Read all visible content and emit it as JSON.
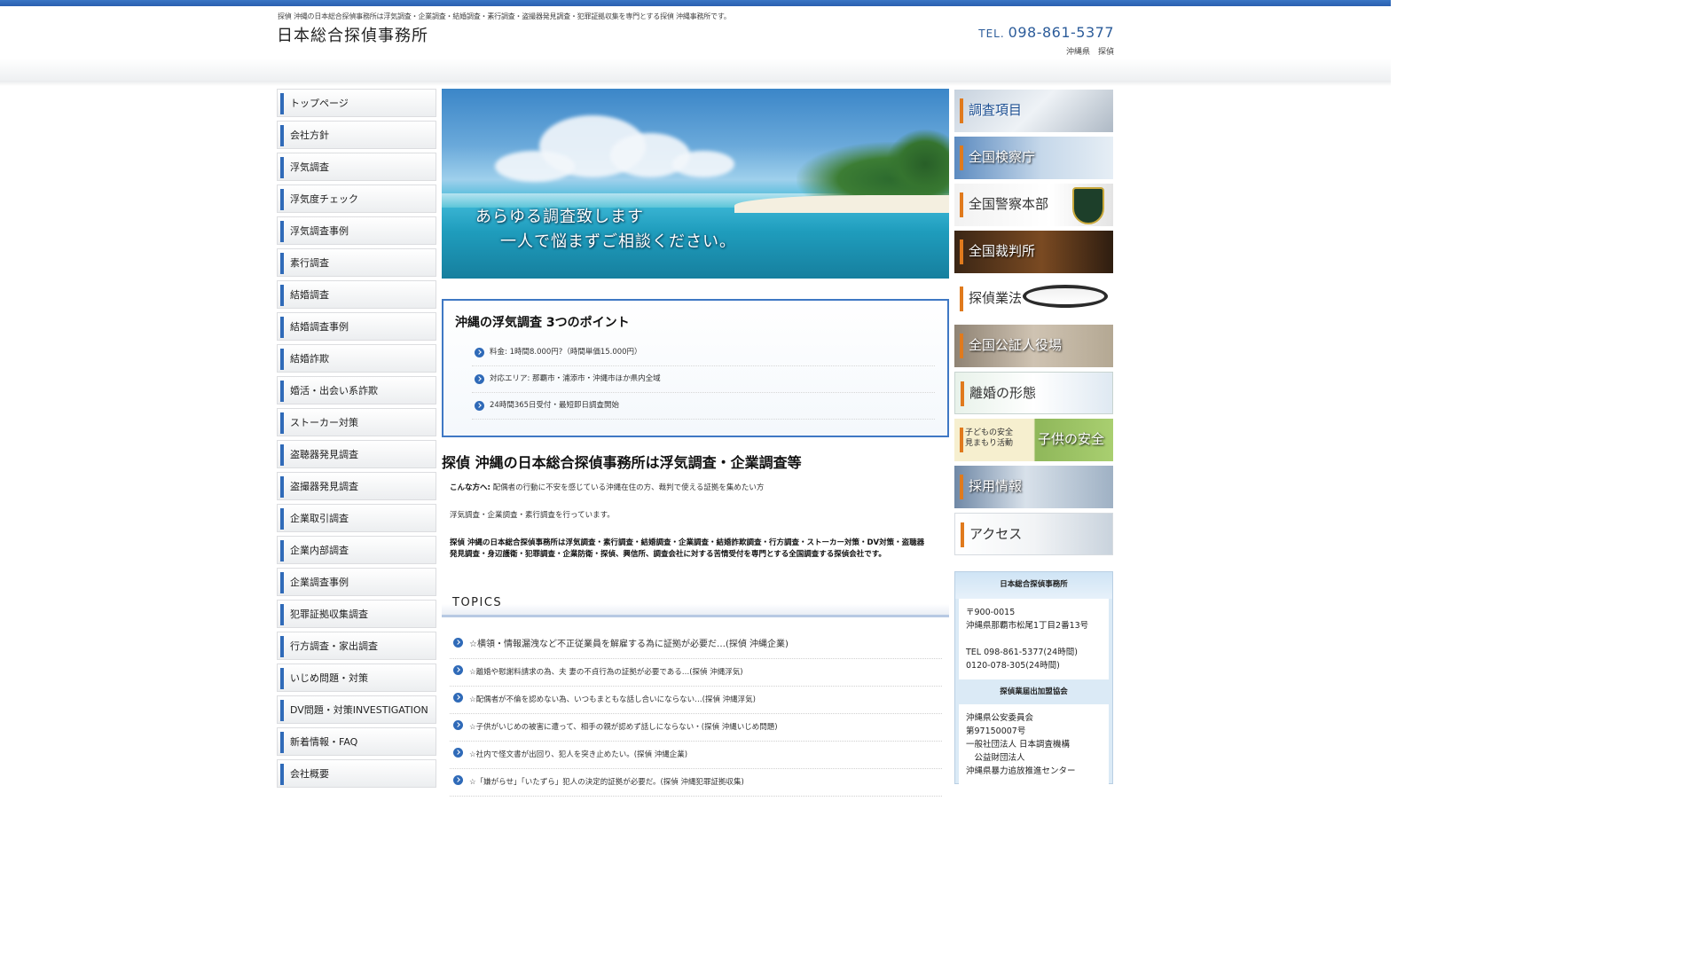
{
  "header": {
    "tagline": "探偵 沖縄の日本総合探偵事務所は浮気調査・企業調査・結婚調査・素行調査・盗撮器発見調査・犯罪証拠収集を専門とする探偵 沖縄事務所です。",
    "site_title": "日本総合探偵事務所",
    "tel_label": "TEL.",
    "tel_number": "098-861-5377",
    "region": "沖縄県　探偵"
  },
  "nav": {
    "items": [
      {
        "label": "トップページ"
      },
      {
        "label": "会社方針"
      },
      {
        "label": "浮気調査"
      },
      {
        "label": "浮気度チェック"
      },
      {
        "label": "浮気調査事例"
      },
      {
        "label": "素行調査"
      },
      {
        "label": "結婚調査"
      },
      {
        "label": "結婚調査事例"
      },
      {
        "label": "結婚詐欺"
      },
      {
        "label": "婚活・出会い系詐欺"
      },
      {
        "label": "ストーカー対策"
      },
      {
        "label": "盗聴器発見調査"
      },
      {
        "label": "盗撮器発見調査"
      },
      {
        "label": "企業取引調査"
      },
      {
        "label": "企業内部調査"
      },
      {
        "label": "企業調査事例"
      },
      {
        "label": "犯罪証拠収集調査"
      },
      {
        "label": "行方調査・家出調査"
      },
      {
        "label": "いじめ問題・対策"
      },
      {
        "label": "DV問題・対策INVESTIGATION"
      },
      {
        "label": "新着情報・FAQ"
      },
      {
        "label": "会社概要"
      }
    ]
  },
  "hero": {
    "line1": "あらゆる調査致します",
    "line2": "一人で悩まずご相談ください。"
  },
  "points": {
    "title": "沖縄の浮気調査 3つのポイント",
    "items": [
      {
        "text": "料金: 1時間8.000円?（時間単価15.000円）"
      },
      {
        "text": "対応エリア: 那覇市・浦添市・沖縄市ほか県内全域"
      },
      {
        "text": "24時間365日受付・最短即日調査開始"
      }
    ]
  },
  "main": {
    "heading": "探偵 沖縄の日本総合探偵事務所は浮気調査・企業調査等",
    "p1_strong": "こんな方へ:",
    "p1_text": " 配偶者の行動に不安を感じている沖縄在住の方、裁判で使える証拠を集めたい方",
    "p2": "浮気調査・企業調査・素行調査を行っています。",
    "p3": "探偵 沖縄の日本総合探偵事務所は浮気調査・素行調査・結婚調査・企業調査・結婚詐欺調査・行方調査・ストーカー対策・DV対策・盗聴器発見調査・身辺護衛・犯罪調査・企業防衛・探偵、興信所、調査会社に対する苦情受付を専門とする全国調査する探偵会社です。"
  },
  "topics": {
    "heading": "TOPICS",
    "items": [
      {
        "text": "☆横領・情報漏洩など不正従業員を解雇する為に証拠が必要だ…(探偵 沖縄企業)"
      },
      {
        "text": "☆離婚や慰謝料請求の為、夫 妻の不貞行為の証拠が必要である…(探偵 沖縄浮気)"
      },
      {
        "text": "☆配偶者が不倫を認めない為、いつもまともな話し合いにならない…(探偵 沖縄浮気)"
      },
      {
        "text": "☆子供がいじめの被害に遭って、相手の親が認めず話しにならない・(探偵 沖縄いじめ問題)"
      },
      {
        "text": "☆社内で怪文書が出回り、犯人を突き止めたい。(探偵 沖縄企業)"
      },
      {
        "text": "☆「嫌がらせ」「いたずら」犯人の決定的証拠が必要だ。(探偵 沖縄犯罪証拠収集)"
      }
    ]
  },
  "banners": [
    {
      "label": "調査項目"
    },
    {
      "label": "全国検察庁"
    },
    {
      "label": "全国警察本部"
    },
    {
      "label": "全国裁判所"
    },
    {
      "label": "探偵業法"
    },
    {
      "label": "全国公証人役場"
    },
    {
      "label": "離婚の形態"
    },
    {
      "label": "子供の安全",
      "small1": "子どもの安全",
      "small2": "見まもり活動"
    },
    {
      "label": "採用情報"
    },
    {
      "label": "アクセス"
    }
  ],
  "office": {
    "name": "日本総合探偵事務所",
    "postal": "〒900-0015",
    "address": "沖縄県那覇市松尾1丁目2番13号",
    "tel": "TEL 098-861-5377(24時間)",
    "free": "0120-078-305(24時間)",
    "assoc_heading": "探偵業届出加盟協会",
    "assoc_lines": [
      "沖縄県公安委員会",
      "第97150007号",
      "一般社団法人 日本調査機構",
      "　公益財団法人",
      "沖縄県暴力追放推進センター"
    ]
  },
  "colors": {
    "accent_blue": "#2f6ab8",
    "banner_mark": "#e07a1d",
    "tel_color": "#2c5c9a"
  }
}
